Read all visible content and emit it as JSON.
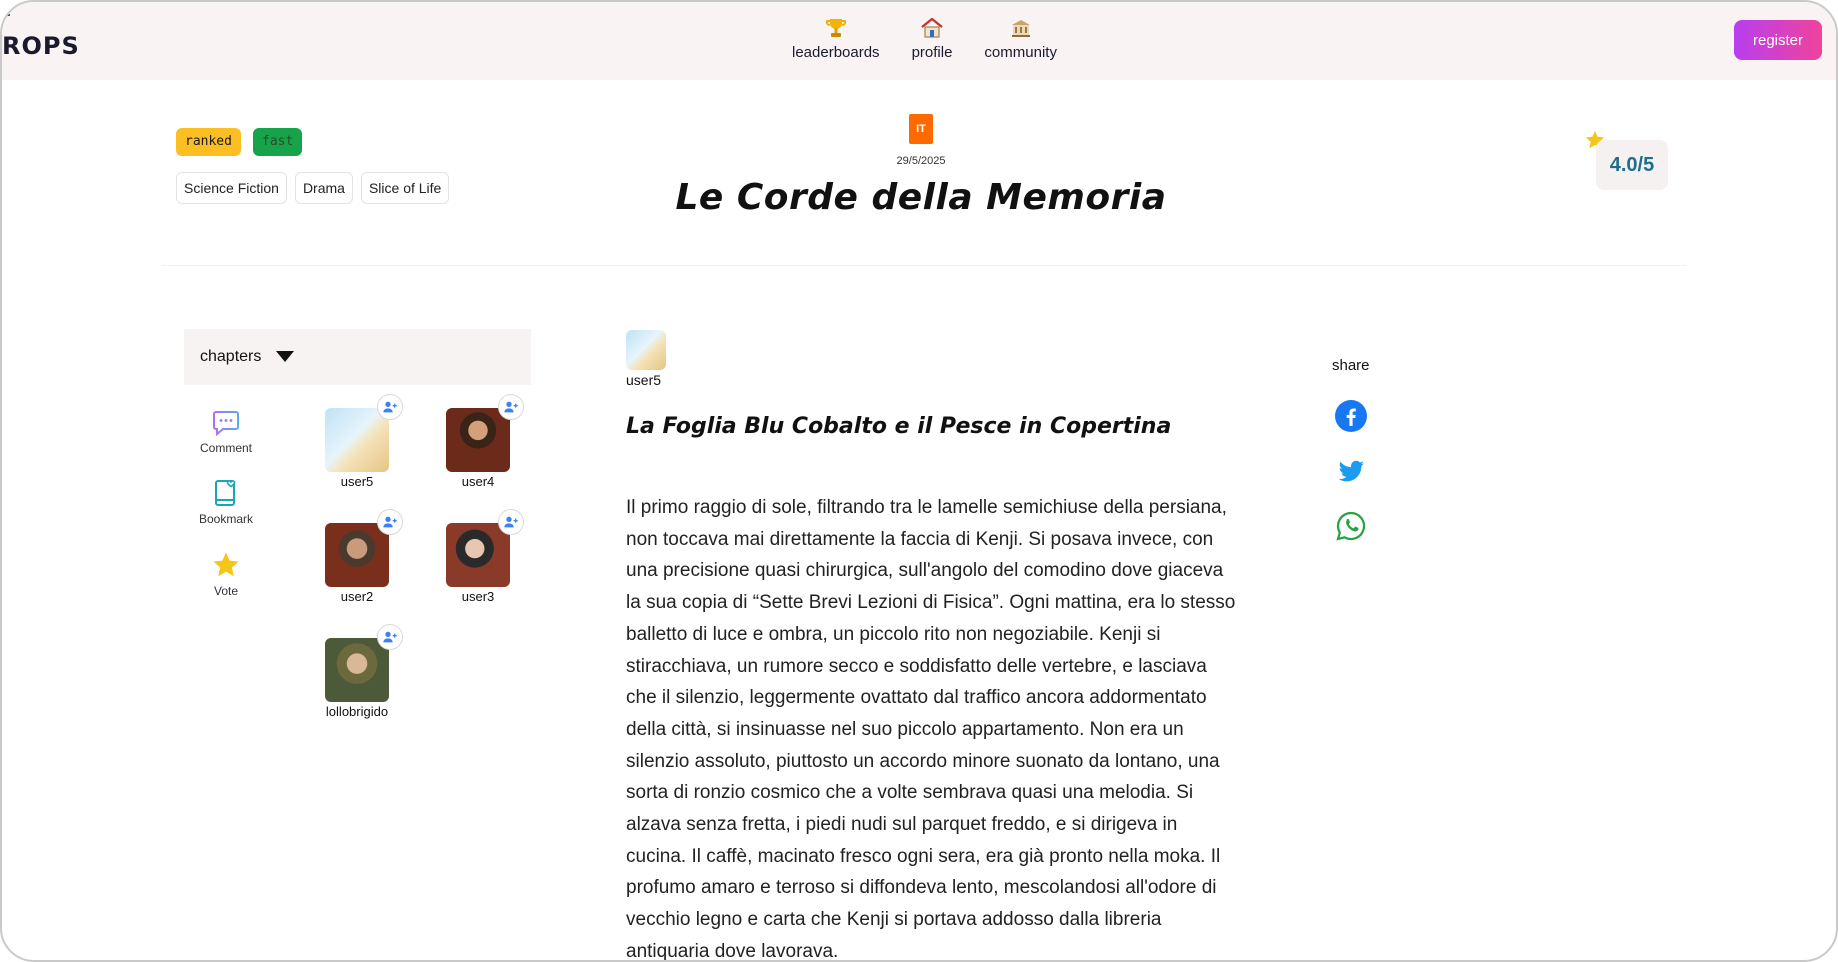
{
  "header": {
    "logo_text": "ROPS",
    "nav": [
      {
        "label": "leaderboards",
        "icon": "trophy-icon"
      },
      {
        "label": "profile",
        "icon": "house-icon"
      },
      {
        "label": "community",
        "icon": "community-building-icon"
      }
    ],
    "register_label": "register"
  },
  "story": {
    "tags": [
      "ranked",
      "fast"
    ],
    "genres": [
      "Science Fiction",
      "Drama",
      "Slice of Life"
    ],
    "language": "IT",
    "date": "29/5/2025",
    "title": "Le Corde della Memoria",
    "rating": "4.0/5"
  },
  "sidebar": {
    "chapters_label": "chapters",
    "actions": [
      {
        "label": "Comment",
        "icon": "comment-icon"
      },
      {
        "label": "Bookmark",
        "icon": "bookmark-icon"
      },
      {
        "label": "Vote",
        "icon": "star-icon"
      }
    ],
    "readers": [
      "user5",
      "user4",
      "user2",
      "user3",
      "lollobrigido"
    ]
  },
  "post": {
    "author": "user5",
    "chapter_title": "La Foglia Blu Cobalto e il Pesce in Copertina",
    "body": "Il primo raggio di sole, filtrando tra le lamelle semichiuse della persiana, non toccava mai direttamente la faccia di Kenji. Si posava invece, con una precisione quasi chirurgica, sull'angolo del comodino dove giaceva la sua copia di “Sette Brevi Lezioni di Fisica”. Ogni mattina, era lo stesso balletto di luce e ombra, un piccolo rito non negoziabile. Kenji si stiracchiava, un rumore secco e soddisfatto delle vertebre, e lasciava che il silenzio, leggermente ovattato dal traffico ancora addormentato della città, si insinuasse nel suo piccolo appartamento. Non era un silenzio assoluto, piuttosto un accordo minore suonato da lontano, una sorta di ronzio cosmico che a volte sembrava quasi una melodia. Si alzava senza fretta, i piedi nudi sul parquet freddo, e si dirigeva in cucina. Il caffè, macinato fresco ogni sera, era già pronto nella moka. Il profumo amaro e terroso si diffondeva lento, mescolandosi all'odore di vecchio legno e carta che Kenji si portava addosso dalla libreria antiquaria dove lavorava."
  },
  "share": {
    "label": "share",
    "buttons": [
      "facebook-icon",
      "twitter-icon",
      "whatsapp-icon"
    ]
  },
  "colors": {
    "accent_gradient_start": "#b83ef0",
    "accent_gradient_end": "#f0439b",
    "ranked_tag": "#fbbf24",
    "fast_tag": "#16a34a",
    "language_badge": "#ff6a00",
    "rating_text": "#1f6d8c"
  }
}
